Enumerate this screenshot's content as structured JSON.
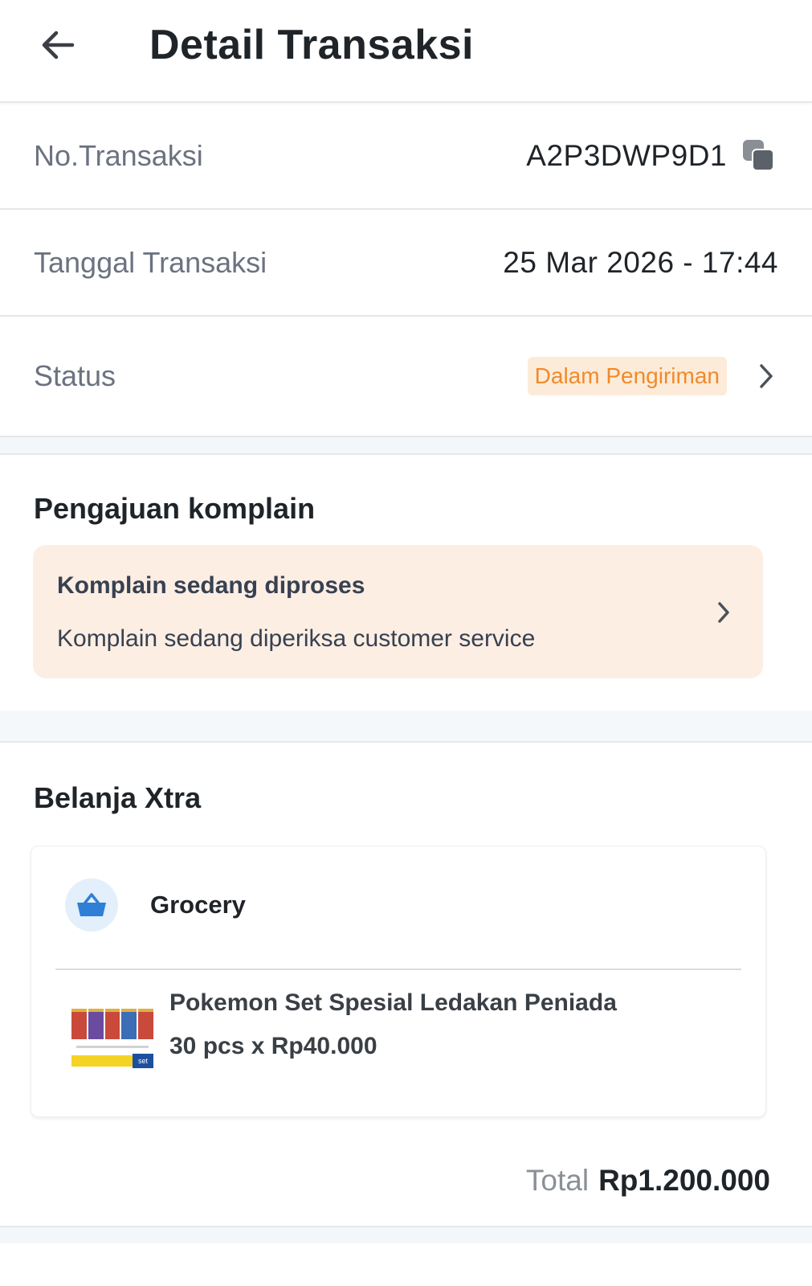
{
  "header": {
    "title": "Detail Transaksi",
    "back_icon": "arrow-left-icon"
  },
  "transaction": {
    "number_label": "No.Transaksi",
    "number_value": "A2P3DWP9D1",
    "copy_icon": "copy-icon",
    "date_label": "Tanggal Transaksi",
    "date_value": "25 Mar 2026 - 17:44",
    "status_label": "Status",
    "status_value": "Dalam Pengiriman",
    "status_color": "#f08a2b",
    "status_bg": "#fdebd9"
  },
  "complaint": {
    "section_title": "Pengajuan komplain",
    "card_title": "Komplain sedang diproses",
    "card_subtitle": "Komplain sedang diperiksa customer service",
    "card_bg": "#fdeee4"
  },
  "order": {
    "section_title": "Belanja Xtra",
    "store_icon": "basket-icon",
    "store_name": "Grocery",
    "items": [
      {
        "name": "Pokemon Set Spesial Ledakan Peniada",
        "quantity_price": "30 pcs x Rp40.000"
      }
    ],
    "total_label": "Total",
    "total_amount": "Rp1.200.000"
  }
}
